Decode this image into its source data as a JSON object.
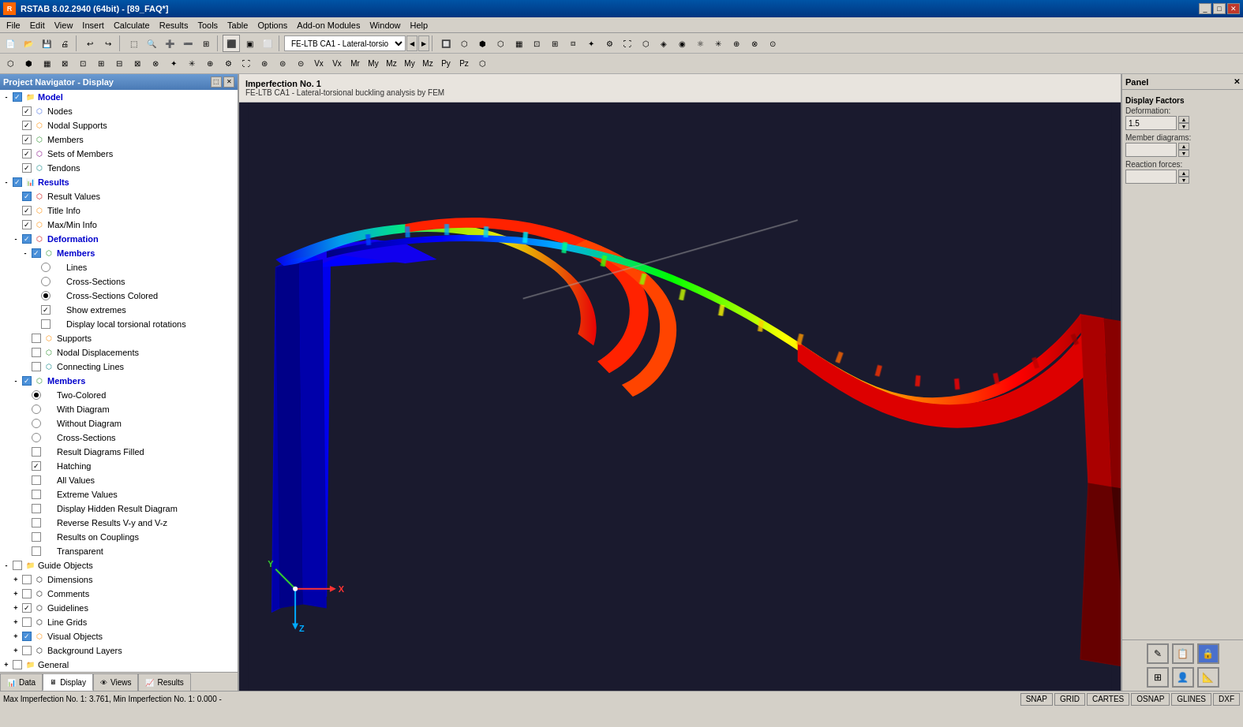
{
  "app": {
    "title": "RSTAB 8.02.2940 (64bit) - [89_FAQ*]",
    "icon": "R"
  },
  "menubar": {
    "items": [
      "File",
      "Edit",
      "View",
      "Insert",
      "Calculate",
      "Results",
      "Tools",
      "Table",
      "Options",
      "Add-on Modules",
      "Window",
      "Help"
    ]
  },
  "left_panel": {
    "title": "Project Navigator - Display",
    "tree": [
      {
        "id": "model",
        "label": "Model",
        "level": 0,
        "type": "checked-blue",
        "expand": "expanded",
        "bold": true
      },
      {
        "id": "nodes",
        "label": "Nodes",
        "level": 1,
        "type": "checked",
        "expand": "leaf"
      },
      {
        "id": "nodal-supports",
        "label": "Nodal Supports",
        "level": 1,
        "type": "checked",
        "expand": "leaf"
      },
      {
        "id": "members",
        "label": "Members",
        "level": 1,
        "type": "checked",
        "expand": "leaf"
      },
      {
        "id": "sets-of-members",
        "label": "Sets of Members",
        "level": 1,
        "type": "checked",
        "expand": "leaf"
      },
      {
        "id": "tendons",
        "label": "Tendons",
        "level": 1,
        "type": "checked",
        "expand": "leaf"
      },
      {
        "id": "results",
        "label": "Results",
        "level": 0,
        "type": "checked-blue",
        "expand": "expanded",
        "bold": true,
        "color": "blue"
      },
      {
        "id": "result-values",
        "label": "Result Values",
        "level": 1,
        "type": "checked-red",
        "expand": "leaf"
      },
      {
        "id": "title-info",
        "label": "Title Info",
        "level": 1,
        "type": "checked",
        "expand": "leaf"
      },
      {
        "id": "max-min-info",
        "label": "Max/Min Info",
        "level": 1,
        "type": "checked",
        "expand": "leaf"
      },
      {
        "id": "deformation",
        "label": "Deformation",
        "level": 1,
        "type": "checked-blue",
        "expand": "expanded"
      },
      {
        "id": "deform-members",
        "label": "Members",
        "level": 2,
        "type": "checked-blue",
        "expand": "expanded"
      },
      {
        "id": "lines",
        "label": "Lines",
        "level": 3,
        "type": "radio-empty",
        "expand": "leaf"
      },
      {
        "id": "cross-sections",
        "label": "Cross-Sections",
        "level": 3,
        "type": "radio-empty",
        "expand": "leaf"
      },
      {
        "id": "cross-sections-colored",
        "label": "Cross-Sections Colored",
        "level": 3,
        "type": "radio-filled",
        "expand": "leaf"
      },
      {
        "id": "show-extremes",
        "label": "Show extremes",
        "level": 3,
        "type": "checked",
        "expand": "leaf"
      },
      {
        "id": "display-local",
        "label": "Display local torsional rotations",
        "level": 3,
        "type": "unchecked",
        "expand": "leaf"
      },
      {
        "id": "supports",
        "label": "Supports",
        "level": 2,
        "type": "unchecked",
        "expand": "leaf"
      },
      {
        "id": "nodal-displacements",
        "label": "Nodal Displacements",
        "level": 2,
        "type": "unchecked",
        "expand": "leaf"
      },
      {
        "id": "connecting-lines",
        "label": "Connecting Lines",
        "level": 2,
        "type": "unchecked",
        "expand": "leaf"
      },
      {
        "id": "members2",
        "label": "Members",
        "level": 1,
        "type": "checked-blue",
        "expand": "expanded"
      },
      {
        "id": "two-colored",
        "label": "Two-Colored",
        "level": 2,
        "type": "radio-empty",
        "expand": "leaf"
      },
      {
        "id": "with-diagram",
        "label": "With Diagram",
        "level": 2,
        "type": "radio-empty",
        "expand": "leaf"
      },
      {
        "id": "without-diagram",
        "label": "Without Diagram",
        "level": 2,
        "type": "radio-empty",
        "expand": "leaf"
      },
      {
        "id": "cross-sections2",
        "label": "Cross-Sections",
        "level": 2,
        "type": "radio-empty",
        "expand": "leaf"
      },
      {
        "id": "result-diagrams-filled",
        "label": "Result Diagrams Filled",
        "level": 2,
        "type": "unchecked",
        "expand": "leaf"
      },
      {
        "id": "hatching",
        "label": "Hatching",
        "level": 2,
        "type": "checked",
        "expand": "leaf"
      },
      {
        "id": "all-values",
        "label": "All Values",
        "level": 2,
        "type": "unchecked",
        "expand": "leaf"
      },
      {
        "id": "extreme-values",
        "label": "Extreme Values",
        "level": 2,
        "type": "unchecked",
        "expand": "leaf"
      },
      {
        "id": "display-hidden",
        "label": "Display Hidden Result Diagram",
        "level": 2,
        "type": "unchecked",
        "expand": "leaf"
      },
      {
        "id": "reverse-results",
        "label": "Reverse Results V-y and V-z",
        "level": 2,
        "type": "unchecked",
        "expand": "leaf"
      },
      {
        "id": "results-couplings",
        "label": "Results on Couplings",
        "level": 2,
        "type": "unchecked",
        "expand": "leaf"
      },
      {
        "id": "transparent",
        "label": "Transparent",
        "level": 2,
        "type": "unchecked",
        "expand": "leaf"
      },
      {
        "id": "guide-objects",
        "label": "Guide Objects",
        "level": 0,
        "type": "unchecked",
        "expand": "expanded"
      },
      {
        "id": "dimensions",
        "label": "Dimensions",
        "level": 1,
        "type": "unchecked",
        "expand": "collapsed"
      },
      {
        "id": "comments",
        "label": "Comments",
        "level": 1,
        "type": "unchecked",
        "expand": "collapsed"
      },
      {
        "id": "guidelines",
        "label": "Guidelines",
        "level": 1,
        "type": "checked",
        "expand": "collapsed"
      },
      {
        "id": "line-grids",
        "label": "Line Grids",
        "level": 1,
        "type": "unchecked",
        "expand": "collapsed"
      },
      {
        "id": "visual-objects",
        "label": "Visual Objects",
        "level": 1,
        "type": "checked-blue",
        "expand": "collapsed"
      },
      {
        "id": "background-layers",
        "label": "Background Layers",
        "level": 1,
        "type": "unchecked",
        "expand": "collapsed"
      },
      {
        "id": "general",
        "label": "General",
        "level": 0,
        "type": "unchecked",
        "expand": "collapsed"
      }
    ]
  },
  "nav_tabs": [
    {
      "id": "data",
      "label": "Data",
      "icon": "📊"
    },
    {
      "id": "display",
      "label": "Display",
      "icon": "🖥",
      "active": true
    },
    {
      "id": "views",
      "label": "Views",
      "icon": "👁"
    },
    {
      "id": "results",
      "label": "Results",
      "icon": "📈"
    }
  ],
  "viewport": {
    "imperfection": "Imperfection No. 1",
    "analysis": "FE-LTB CA1 - Lateral-torsional buckling analysis by FEM"
  },
  "right_panel": {
    "title": "Panel",
    "display_factors": "Display Factors",
    "deformation_label": "Deformation:",
    "deformation_value": "1.5",
    "member_diagrams_label": "Member diagrams:",
    "member_diagrams_value": "",
    "reaction_forces_label": "Reaction forces:",
    "reaction_forces_value": ""
  },
  "statusbar": {
    "message": "Max Imperfection No. 1: 3.761, Min Imperfection No. 1: 0.000 -",
    "buttons": [
      "SNAP",
      "GRID",
      "CARTES",
      "OSNAP",
      "GLINES",
      "DXF"
    ]
  },
  "toolbar": {
    "dropdown_value": "FE-LTB CA1 - Lateral-torsio"
  }
}
